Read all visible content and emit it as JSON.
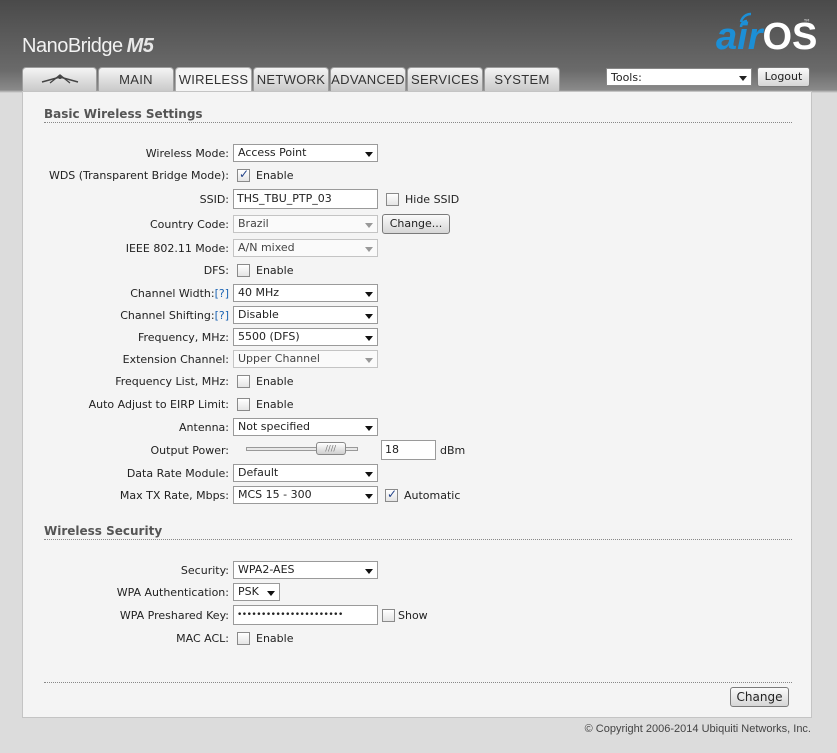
{
  "header": {
    "product_name": "NanoBridge",
    "product_model": "M5",
    "logo_air": "air",
    "logo_os": "OS",
    "logo_tm": "™"
  },
  "tabs": [
    {
      "label": "",
      "icon": "ubiquiti-logo-icon"
    },
    {
      "label": "MAIN"
    },
    {
      "label": "WIRELESS",
      "active": true
    },
    {
      "label": "NETWORK"
    },
    {
      "label": "ADVANCED"
    },
    {
      "label": "SERVICES"
    },
    {
      "label": "SYSTEM"
    }
  ],
  "toolbar": {
    "tools_value": "Tools:",
    "logout_label": "Logout"
  },
  "basic": {
    "title": "Basic Wireless Settings",
    "wireless_mode": {
      "label": "Wireless Mode:",
      "value": "Access Point"
    },
    "wds": {
      "label": "WDS (Transparent Bridge Mode):",
      "option": "Enable",
      "checked": true
    },
    "ssid": {
      "label": "SSID:",
      "value": "THS_TBU_PTP_03",
      "hide_label": "Hide SSID",
      "hide_checked": false
    },
    "country": {
      "label": "Country Code:",
      "value": "Brazil",
      "change_label": "Change..."
    },
    "ieee": {
      "label": "IEEE 802.11 Mode:",
      "value": "A/N mixed"
    },
    "dfs": {
      "label": "DFS:",
      "option": "Enable",
      "checked": false
    },
    "channel_width": {
      "label": "Channel Width:",
      "help": "[?]",
      "value": "40 MHz"
    },
    "channel_shifting": {
      "label": "Channel Shifting:",
      "help": "[?]",
      "value": "Disable"
    },
    "frequency": {
      "label": "Frequency, MHz:",
      "value": "5500 (DFS)"
    },
    "extension": {
      "label": "Extension Channel:",
      "value": "Upper Channel"
    },
    "freq_list": {
      "label": "Frequency List, MHz:",
      "option": "Enable",
      "checked": false
    },
    "eirp": {
      "label": "Auto Adjust to EIRP Limit:",
      "option": "Enable",
      "checked": false
    },
    "antenna": {
      "label": "Antenna:",
      "value": "Not specified"
    },
    "output_power": {
      "label": "Output Power:",
      "value": "18",
      "unit": "dBm",
      "slider_fraction": 0.85
    },
    "data_rate": {
      "label": "Data Rate Module:",
      "value": "Default"
    },
    "max_tx": {
      "label": "Max TX Rate, Mbps:",
      "value": "MCS 15 - 300",
      "auto_label": "Automatic",
      "auto_checked": true
    }
  },
  "security": {
    "title": "Wireless Security",
    "security": {
      "label": "Security:",
      "value": "WPA2-AES"
    },
    "wpa_auth": {
      "label": "WPA Authentication:",
      "value": "PSK"
    },
    "wpa_key": {
      "label": "WPA Preshared Key:",
      "value": "••••••••••••••••••••••",
      "show_label": "Show",
      "show_checked": false
    },
    "mac_acl": {
      "label": "MAC ACL:",
      "option": "Enable",
      "checked": false
    }
  },
  "footer": {
    "change_label": "Change",
    "copyright": "© Copyright 2006-2014 Ubiquiti Networks, Inc."
  },
  "colors": {
    "accent": "#1c8fd6",
    "header_bg": "#4a4a4a",
    "panel_bg": "#f4f4f4",
    "help_link": "#1c64b4"
  }
}
